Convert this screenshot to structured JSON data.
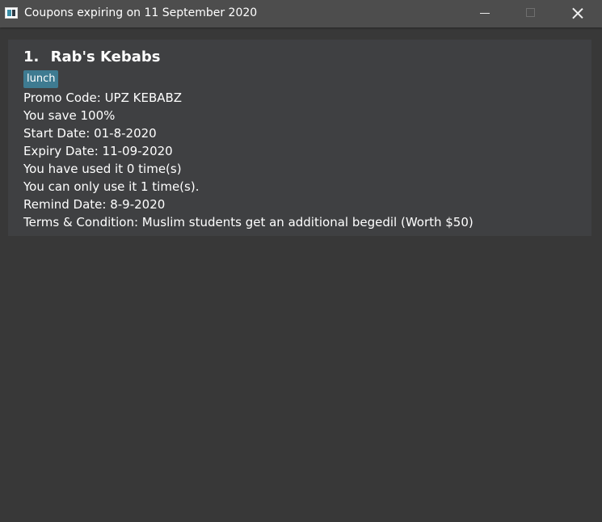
{
  "window": {
    "title": "Coupons expiring on 11 September 2020"
  },
  "coupon": {
    "index": "1.",
    "name": "Rab's Kebabs",
    "tag": "lunch",
    "promo_code": "Promo Code: UPZ KEBABZ",
    "savings": "You save 100%",
    "start_date": "Start Date: 01-8-2020",
    "expiry_date": "Expiry Date: 11-09-2020",
    "usage": "You have used it 0 time(s)",
    "limit": "You can only use it 1 time(s).",
    "remind_date": "Remind Date: 8-9-2020",
    "terms": "Terms & Condition: Muslim students get an additional begedil (Worth $50)"
  },
  "colors": {
    "titlebar": "#4d4d4d",
    "background": "#383838",
    "card": "#3f4042",
    "tag": "#3e7b91",
    "text": "#ffffff"
  },
  "icons": {
    "app": "app-icon",
    "minimize": "minimize-icon",
    "maximize": "maximize-icon",
    "close": "close-icon"
  }
}
